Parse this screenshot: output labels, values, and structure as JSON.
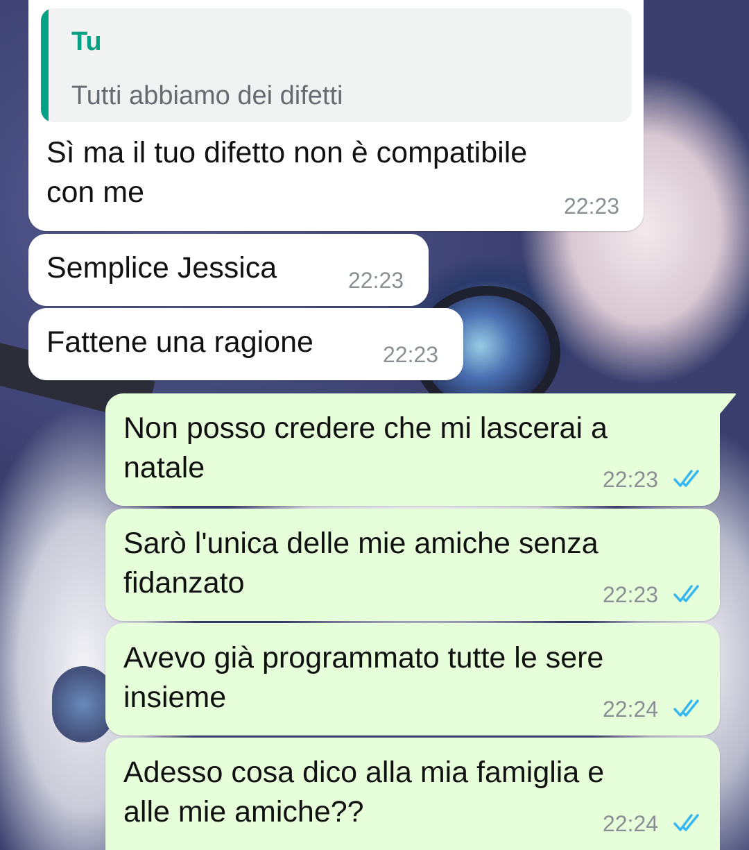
{
  "colors": {
    "incoming_bubble": "#ffffff",
    "outgoing_bubble": "#e6ffda",
    "quote_accent": "#06a085",
    "read_ticks": "#34b7f1",
    "timestamp": "#8a8f94"
  },
  "messages": [
    {
      "direction": "incoming",
      "quote": {
        "author": "Tu",
        "text": "Tutti abbiamo dei difetti"
      },
      "lines": [
        "Sì ma il tuo difetto non è compatibile",
        "con me"
      ],
      "time": "22:23"
    },
    {
      "direction": "incoming",
      "lines": [
        "Semplice Jessica"
      ],
      "time": "22:23"
    },
    {
      "direction": "incoming",
      "lines": [
        "Fattene una ragione"
      ],
      "time": "22:23"
    },
    {
      "direction": "outgoing",
      "lines": [
        "Non posso credere che mi lascerai a",
        "natale"
      ],
      "time": "22:23",
      "status_icon": "double-check-read-icon"
    },
    {
      "direction": "outgoing",
      "lines": [
        "Sarò l'unica delle mie amiche senza",
        "fidanzato"
      ],
      "time": "22:23",
      "status_icon": "double-check-read-icon"
    },
    {
      "direction": "outgoing",
      "lines": [
        "Avevo già programmato tutte le sere",
        "insieme"
      ],
      "time": "22:24",
      "status_icon": "double-check-read-icon"
    },
    {
      "direction": "outgoing",
      "lines": [
        "Adesso cosa dico alla mia famiglia e",
        "alle mie amiche??"
      ],
      "time": "22:24",
      "status_icon": "double-check-read-icon"
    }
  ]
}
